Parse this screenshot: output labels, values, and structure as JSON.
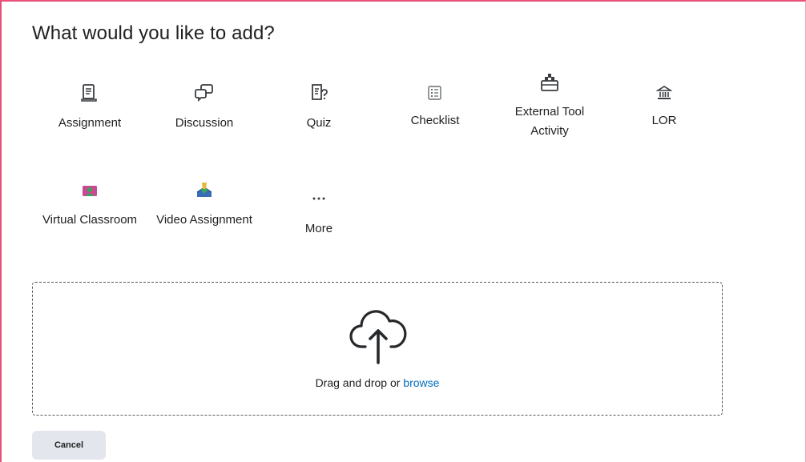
{
  "dialog": {
    "title": "What would you like to add?",
    "tiles": [
      {
        "label": "Assignment",
        "icon": "assignment-icon"
      },
      {
        "label": "Discussion",
        "icon": "discussion-icon"
      },
      {
        "label": "Quiz",
        "icon": "quiz-icon"
      },
      {
        "label": "Checklist",
        "icon": "checklist-icon"
      },
      {
        "label": "External Tool Activity",
        "icon": "external-tool-icon"
      },
      {
        "label": "LOR",
        "icon": "lor-icon"
      },
      {
        "label": "Virtual Classroom",
        "icon": "virtual-classroom-icon"
      },
      {
        "label": "Video Assignment",
        "icon": "video-assignment-icon"
      },
      {
        "label": "More",
        "icon": "more-icon"
      }
    ],
    "dropzone": {
      "text": "Drag and drop or ",
      "browse_label": "browse",
      "icon": "upload-cloud-icon"
    },
    "cancel_label": "Cancel"
  },
  "colors": {
    "frame_border": "#e8507a",
    "link": "#006fbf",
    "cancel_bg": "#e3e6ec"
  }
}
